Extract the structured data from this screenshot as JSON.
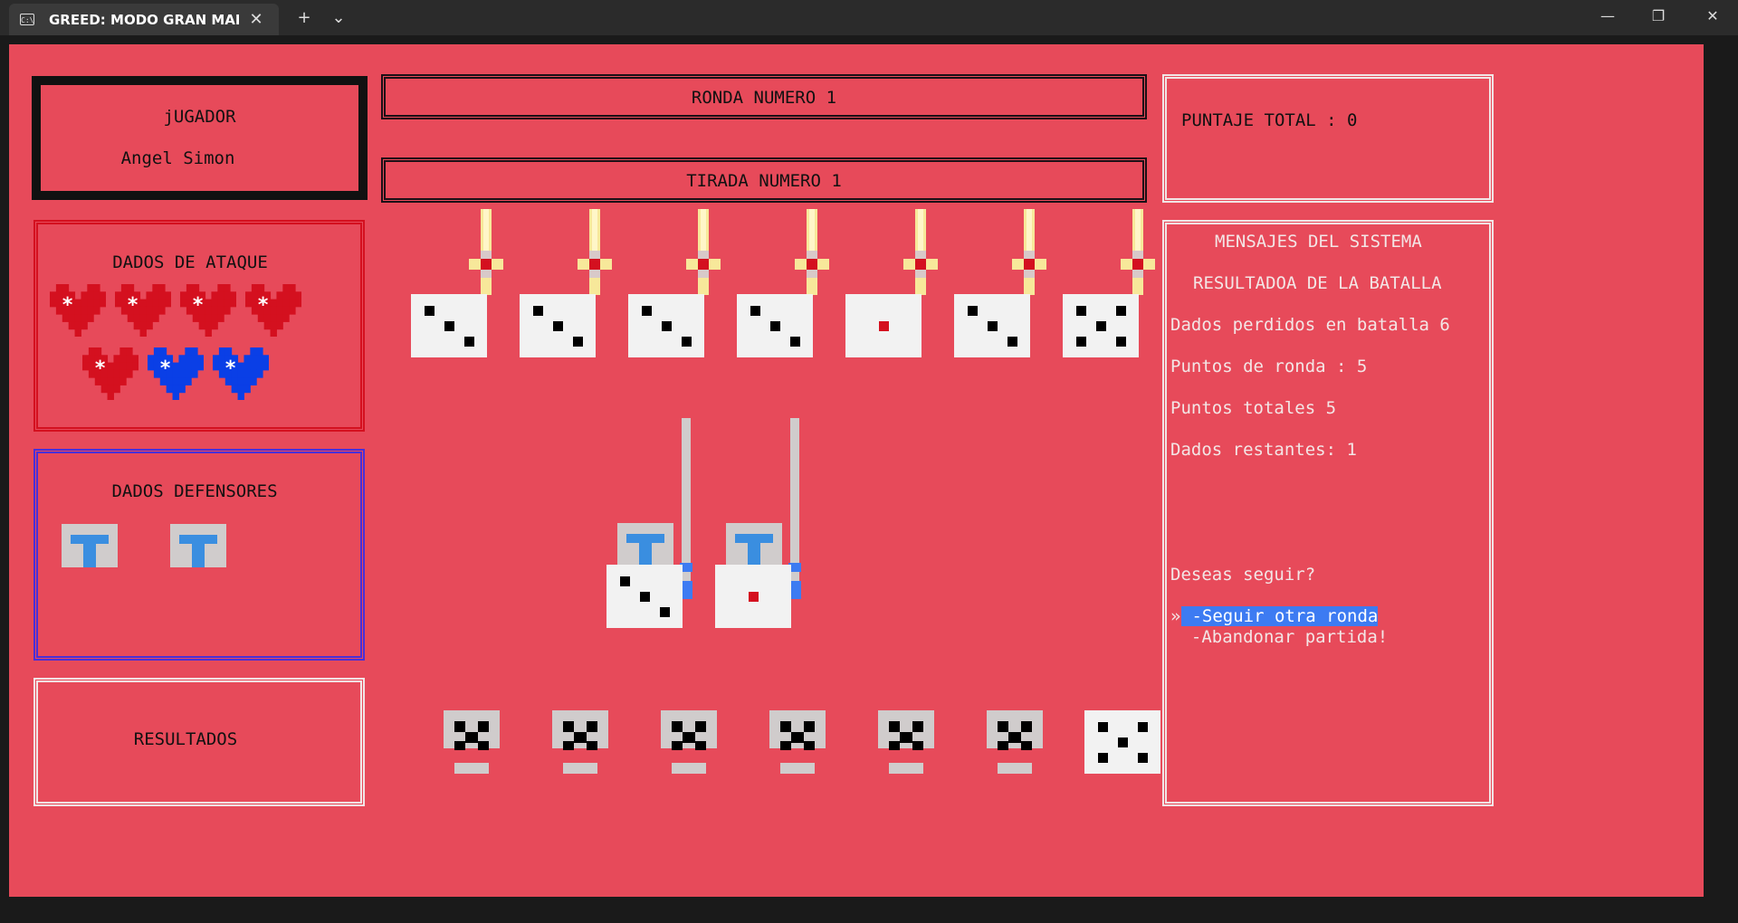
{
  "window": {
    "tab_title": "GREED: MODO GRAN MAESTRO",
    "tab_icon": "terminal-icon",
    "new_tab_label": "+",
    "dropdown_label": "⌄",
    "minimize_label": "—",
    "maximize_label": "❐",
    "close_label": "✕"
  },
  "colors": {
    "background": "#e74a5a",
    "attack_red": "#d4101f",
    "attack_blue": "#0a3fe6",
    "die_face": "#f2f2f2",
    "selection": "#3d7bf2"
  },
  "player": {
    "heading": "jUGADOR",
    "name": "Angel Simon"
  },
  "round": {
    "label": "RONDA NUMERO 1"
  },
  "roll": {
    "label": "TIRADA NUMERO 1"
  },
  "score": {
    "label": "PUNTAJE TOTAL : 0"
  },
  "attack_dice": {
    "title": "DADOS DE ATAQUE",
    "hearts": [
      {
        "color": "red",
        "mark": "*"
      },
      {
        "color": "red",
        "mark": "*"
      },
      {
        "color": "red",
        "mark": "*"
      },
      {
        "color": "red",
        "mark": "*"
      },
      {
        "color": "red",
        "mark": "*"
      },
      {
        "color": "blue",
        "mark": "*"
      },
      {
        "color": "blue",
        "mark": "*"
      }
    ]
  },
  "defender_dice": {
    "title": "DADOS DEFENSORES",
    "shield_count": 2
  },
  "results": {
    "title": "RESULTADOS"
  },
  "battle_dice": {
    "top_row": [
      3,
      3,
      3,
      3,
      1,
      3,
      5
    ],
    "defenders": [
      3,
      1
    ],
    "bottom_row": [
      "skull",
      "skull",
      "skull",
      "skull",
      "skull",
      "skull",
      5
    ]
  },
  "messages": {
    "title": "MENSAJES DEL SISTEMA",
    "subtitle": "RESULTADOA DE LA BATALLA",
    "lost_dice": "Dados perdidos en batalla 6",
    "round_points": "Puntos de ronda : 5",
    "total_points": "Puntos totales 5",
    "remaining_dice": "Dados restantes: 1",
    "question": "Deseas seguir?",
    "cursor": "»",
    "option_continue": " -Seguir otra ronda",
    "option_quit": "  -Abandonar partida!"
  }
}
